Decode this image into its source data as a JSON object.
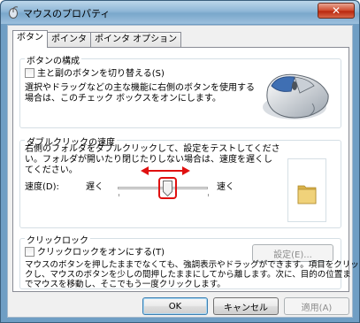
{
  "window": {
    "title": "マウスのプロパティ",
    "close_label": "✕"
  },
  "tabs": [
    {
      "label": "ボタン"
    },
    {
      "label": "ポインタ"
    },
    {
      "label": "ポインタ オプション"
    }
  ],
  "buttons_group": {
    "title": "ボタンの構成",
    "checkbox_label": "主と副のボタンを切り替える(S)",
    "description_line1": "選択やドラッグなどの主な機能に右側のボタンを使用する",
    "description_line2": "場合は、このチェック ボックスをオンにします。"
  },
  "dblclick_group": {
    "title": "ダブルクリックの速度",
    "description_line1": "右側のフォルダをダブルクリックして、設定をテストしてくださ",
    "description_line2": "い。フォルダが開いたり閉じたりしない場合は、速度を遅くし",
    "description_line3": "てください。",
    "speed_label": "速度(D):",
    "slow_label": "遅く",
    "fast_label": "速く",
    "slider_value": 0.55
  },
  "clicklock_group": {
    "title": "クリックロック",
    "checkbox_label": "クリックロックをオンにする(T)",
    "settings_button": "設定(E)...",
    "description_line1": "マウスのボタンを押したままでなくても、強調表示やドラッグができます。項目をクリッ",
    "description_line2": "クし、マウスのボタンを少しの間押したままにしてから離します。次に、目的の位置ま",
    "description_line3": "でマウスを移動し、そこでもう一度クリックします。"
  },
  "footer": {
    "ok": "OK",
    "cancel": "キャンセル",
    "apply": "適用(A)"
  },
  "colors": {
    "highlight": "#e01010",
    "folder": "#e8c75c"
  }
}
